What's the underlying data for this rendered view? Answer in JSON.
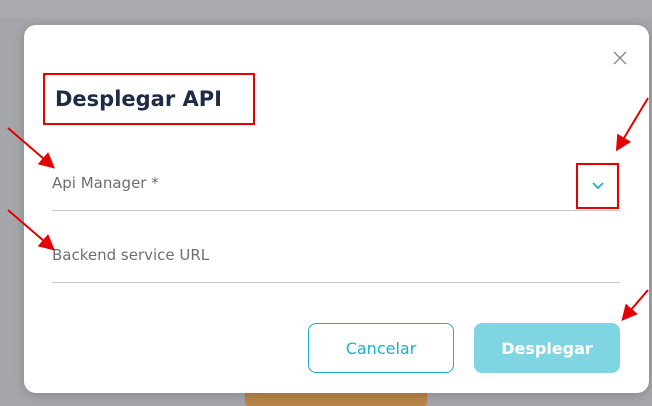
{
  "dialog": {
    "title": "Desplegar API",
    "close_icon": "close-icon"
  },
  "form": {
    "api_manager_label": "Api Manager *",
    "backend_url_label": "Backend service URL",
    "dropdown_icon": "chevron-down-icon"
  },
  "actions": {
    "cancel_label": "Cancelar",
    "deploy_label": "Desplegar"
  },
  "colors": {
    "accent": "#17b3c8",
    "accent_disabled": "#7fd6e2",
    "annotation_red": "#e60000",
    "title_text": "#1f2a44"
  }
}
